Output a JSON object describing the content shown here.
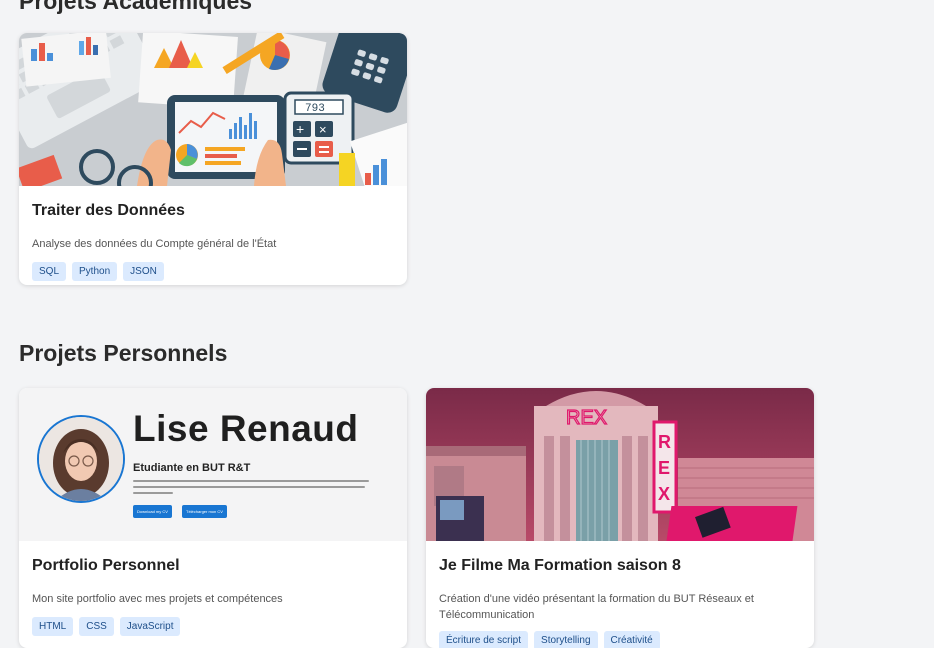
{
  "sections": {
    "academic_title": "Projets Académiques",
    "personal_title": "Projets Personnels"
  },
  "academic_projects": [
    {
      "title": "Traiter des Données",
      "description": "Analyse des données du Compte général de l'État",
      "tags": [
        "SQL",
        "Python",
        "JSON"
      ],
      "image": "data-analysis-illustration",
      "calculator_display": "793"
    }
  ],
  "personal_projects": [
    {
      "title": "Portfolio Personnel",
      "description": "Mon site portfolio avec mes projets et compétences",
      "tags": [
        "HTML",
        "CSS",
        "JavaScript"
      ],
      "image": "portfolio-preview",
      "preview": {
        "name": "Lise Renaud",
        "subtitle": "Etudiante en BUT R&T",
        "button_1": "Download my CV",
        "button_2": "Télécharger mon CV"
      }
    },
    {
      "title": "Je Filme Ma Formation saison 8",
      "description": "Création d'une vidéo présentant la formation du BUT Réseaux et Télécommunication",
      "tags": [
        "Écriture de script",
        "Storytelling",
        "Créativité"
      ],
      "image": "rex-cinema-illustration",
      "sign": "REX"
    }
  ],
  "colors": {
    "background": "#f3f4f6",
    "tag_bg": "#dbeafe",
    "tag_text": "#1e4f8a",
    "accent": "#1976d2"
  }
}
